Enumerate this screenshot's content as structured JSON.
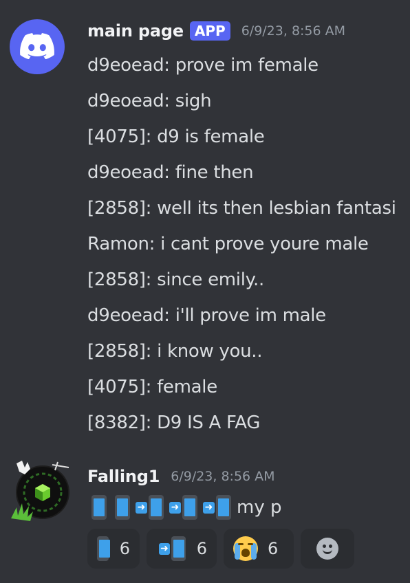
{
  "message1": {
    "username": "main page",
    "badge": "APP",
    "timestamp": "6/9/23, 8:56 AM",
    "lines": [
      "d9eoead: prove im female",
      "d9eoead: sigh",
      "[4075]: d9 is female",
      "d9eoead: fine then",
      "[2858]: well its then lesbian fantasi",
      "Ramon: i cant prove youre male",
      "[2858]: since emily..",
      "d9eoead: i'll prove im male",
      "[2858]: i know you..",
      "[4075]: female",
      "[8382]: D9 IS A FAG"
    ]
  },
  "message2": {
    "username": "Falling1",
    "timestamp": "6/9/23, 8:56 AM",
    "emoji_sequence": [
      "mobile-phone",
      "mobile-phone",
      "mobile-phone-arrow",
      "mobile-phone-arrow",
      "mobile-phone-arrow"
    ],
    "trailing_text": "my p",
    "reactions": [
      {
        "emoji": "mobile-phone",
        "count": "6"
      },
      {
        "emoji": "mobile-phone-arrow",
        "count": "6"
      },
      {
        "emoji": "loudly-crying-face",
        "count": "6"
      }
    ]
  },
  "colors": {
    "background": "#313338",
    "blurple": "#5865f2",
    "text": "#dbdee1",
    "muted": "#949ba4"
  }
}
